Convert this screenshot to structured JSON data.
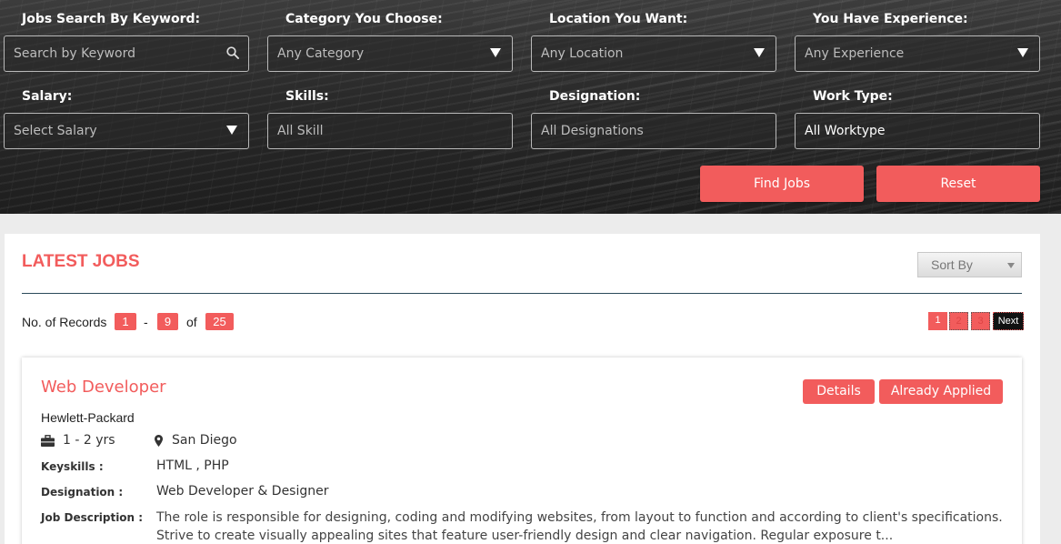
{
  "search": {
    "keyword_label": "Jobs Search By Keyword:",
    "keyword_placeholder": "Search by Keyword",
    "category_label": "Category You Choose:",
    "category_value": "Any Category",
    "location_label": "Location You Want:",
    "location_value": "Any Location",
    "experience_label": "You Have Experience:",
    "experience_value": "Any Experience",
    "salary_label": "Salary:",
    "salary_value": "Select Salary",
    "skills_label": "Skills:",
    "skills_value": "All Skill",
    "designation_label": "Designation:",
    "designation_value": "All Designations",
    "worktype_label": "Work Type:",
    "worktype_value": "All Worktype",
    "find_button": "Find Jobs",
    "reset_button": "Reset"
  },
  "listing": {
    "title": "LATEST JOBS",
    "sort_label": "Sort By",
    "records_prefix": "No. of Records",
    "records_from": "1",
    "records_dash": "-",
    "records_to": "9",
    "records_of": "of",
    "records_total": "25",
    "pages": [
      "1",
      "2",
      "3"
    ],
    "next_label": "Next"
  },
  "job": {
    "title": "Web Developer",
    "details_button": "Details",
    "applied_button": "Already Applied",
    "company": "Hewlett-Packard",
    "experience": "1 - 2 yrs",
    "location": "San Diego",
    "keyskills_label": "Keyskills :",
    "keyskills_value": "HTML , PHP",
    "designation_label": "Designation :",
    "designation_value": "Web Developer & Designer",
    "description_label": "Job Description :",
    "description_value": "The role is responsible for designing, coding and modifying websites, from layout to function and according to client's specifications. Strive to create visually appealing sites that feature user-friendly design and clear navigation. Regular exposure t..."
  },
  "colors": {
    "accent": "#f25c5c",
    "header_bg": "#2a2a2a",
    "divider": "#2b4a5a"
  },
  "icons": [
    "search-icon",
    "dropdown-arrow-icon",
    "briefcase-icon",
    "map-marker-icon"
  ]
}
